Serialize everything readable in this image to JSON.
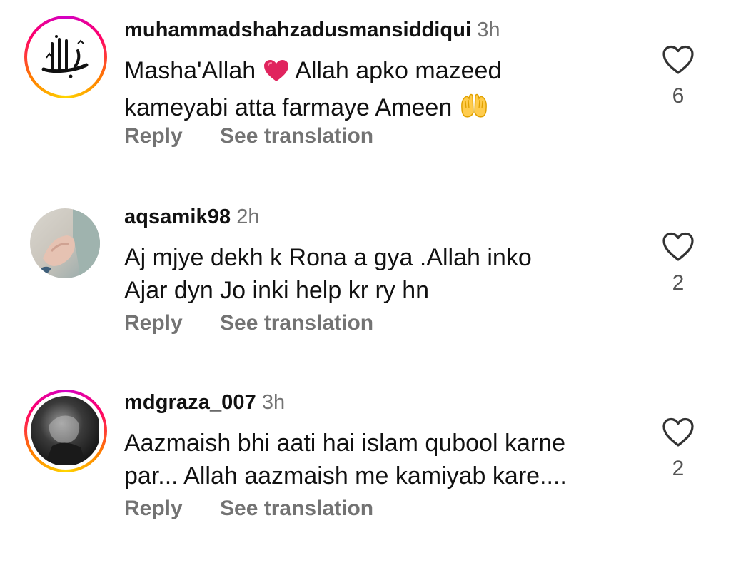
{
  "comments": [
    {
      "username": "muhammadshahzadusmansiddiqui",
      "time": "3h",
      "text_line1": "Masha'Allah",
      "text_line1_rest": "Allah apko mazeed",
      "text_line2": "kameyabi atta farmaye Ameen",
      "emojis": [
        "red-heart-emoji",
        "raising-hands-emoji"
      ],
      "likes": "6",
      "reply_label": "Reply",
      "translate_label": "See translation",
      "avatar": "allah-calligraphy-avatar",
      "has_story": true
    },
    {
      "username": "aqsamik98",
      "time": "2h",
      "text_line1": "Aj mjye dekh k Rona a gya .Allah inko",
      "text_line2": "Ajar dyn Jo inki help kr ry hn",
      "likes": "2",
      "reply_label": "Reply",
      "translate_label": "See translation",
      "avatar": "hands-photo-avatar",
      "has_story": false
    },
    {
      "username": "mdgraza_007",
      "time": "3h",
      "text_line1": "Aazmaish bhi aati hai islam qubool karne",
      "text_line2": "par... Allah aazmaish me kamiyab kare....",
      "likes": "2",
      "reply_label": "Reply",
      "translate_label": "See translation",
      "avatar": "dark-portrait-avatar",
      "has_story": true
    }
  ],
  "colors": {
    "secondary_text": "#737373",
    "primary_text": "#111111",
    "heart_emoji": "#e0245e",
    "story_ring": [
      "#d300c5",
      "#ff0069",
      "#ff7a00",
      "#ffd600"
    ]
  }
}
